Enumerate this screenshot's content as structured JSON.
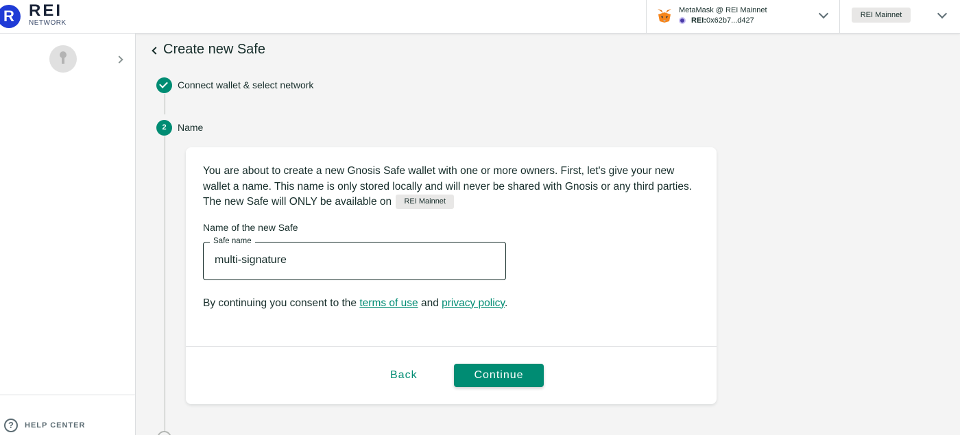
{
  "header": {
    "logo": {
      "title": "REI",
      "subtitle": "NETWORK"
    },
    "wallet": {
      "name": "MetaMask @ REI Mainnet",
      "network_prefix": "REI:",
      "address": "0x62b7...d427"
    },
    "network": {
      "label": "REI Mainnet"
    }
  },
  "sidebar": {
    "help_label": "HELP CENTER"
  },
  "main": {
    "title": "Create new Safe",
    "steps": [
      {
        "number": "",
        "label": "Connect wallet & select network",
        "state": "completed"
      },
      {
        "number": "2",
        "label": "Name",
        "state": "active"
      }
    ],
    "card": {
      "intro_text": "You are about to create a new Gnosis Safe wallet with one or more owners. First, let's give your new wallet a name. This name is only stored locally and will never be shared with Gnosis or any third parties. The new Safe will ONLY be available on",
      "network_badge": "REI Mainnet",
      "field_title": "Name of the new Safe",
      "field_label": "Safe name",
      "field_value": "multi-signature",
      "consent_prefix": "By continuing you consent to the",
      "terms_link": "terms of use",
      "consent_and": "and",
      "privacy_link": "privacy policy",
      "consent_suffix": ".",
      "back_label": "Back",
      "continue_label": "Continue"
    }
  },
  "colors": {
    "accent": "#008c73",
    "brand": "#1f3bd6",
    "text": "#162d2a",
    "background": "#f4f4f4"
  }
}
